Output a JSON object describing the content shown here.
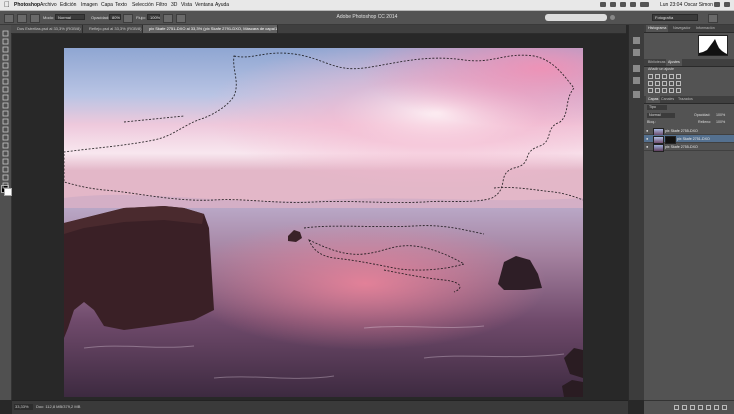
{
  "menubar": {
    "apple_icon": "apple-icon",
    "items": [
      "Photoshop",
      "Archivo",
      "Edición",
      "Imagen",
      "Capa",
      "Texto",
      "Selección",
      "Filtro",
      "3D",
      "Vista",
      "Ventana",
      "Ayuda"
    ],
    "clock": "Lun 23:04",
    "user": "Oscar Simon"
  },
  "window_title": "Adobe Photoshop CC 2014",
  "options_bar": {
    "mode_label": "Modo:",
    "mode_value": "Normal",
    "opacity_label": "Opacidad:",
    "opacity_value": "80%",
    "flow_label": "Flujo:",
    "flow_value": "100%",
    "search_placeholder": "",
    "workspace": "Fotografía"
  },
  "document_tabs": [
    {
      "label": "Dos Estrellas.psd al 33,3% (RGB/8) *"
    },
    {
      "label": "Reflejo.psd al 33,3% (RGB/8) *"
    },
    {
      "label": "pix Skafe 2751-DXO al 33,3% (pix Skafe 2791-DXO, Máscara de capa/16) *",
      "active": true
    }
  ],
  "panels": {
    "top_tabs": [
      "Histograma",
      "Navegador",
      "Información"
    ],
    "adjust_tabs": [
      "Bibliotecas",
      "Ajustes"
    ],
    "adjust_hint": "Añadir un ajuste",
    "layers_tabs": [
      "Capas",
      "Canales",
      "Trazados"
    ],
    "layer_kind": "Tipo",
    "blend_mode": "Normal",
    "opacity_label": "Opacidad:",
    "opacity_value": "100%",
    "lock_label": "Bloq.:",
    "fill_label": "Relleno:",
    "fill_value": "100%",
    "layers": [
      {
        "name": "pix Skafe 2755-DXO",
        "selected": false
      },
      {
        "name": "pix Skafe 2751-DXO",
        "selected": true
      },
      {
        "name": "pix Skafe 2755-DXO",
        "selected": false
      }
    ]
  },
  "status": {
    "zoom": "33,33%",
    "doc_size": "Doc: 112,8 MB/379,2 MB"
  },
  "colors": {
    "accent": "#54708f",
    "ui_dark": "#282828",
    "panel": "#535353"
  }
}
